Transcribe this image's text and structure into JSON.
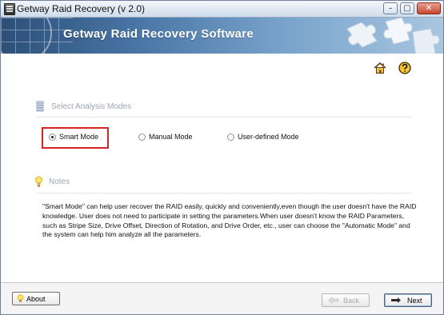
{
  "window": {
    "title": "Getway Raid Recovery (v 2.0)",
    "minimize": "–",
    "maximize": "▢",
    "close": "✕"
  },
  "banner": {
    "title": "Getway Raid Recovery Software"
  },
  "modes_section": {
    "title": "Select Analysis Modes",
    "options": [
      {
        "label": "Smart Mode",
        "selected": true
      },
      {
        "label": "Manual Mode",
        "selected": false
      },
      {
        "label": "User-defined Mode",
        "selected": false
      }
    ]
  },
  "notes_section": {
    "title": "Notes",
    "text": "\"Smart Mode\" can help user recover the RAID easily, quickly and conveniently,even though the user doesn't have the RAID knowledge. User does not need to participate in setting the parameters.When user doesn't know the RAID Parameters, such as Stripe Size, Drive Offset, Direction of Rotation, and Drive Order,  etc., user can choose the \"Automatic Mode\" and the system can help him analyze all the parameters."
  },
  "footer": {
    "about_label": "About",
    "back_label": "Back",
    "next_label": "Next",
    "back_enabled": false
  },
  "colors": {
    "banner_dark": "#2c4f79",
    "highlight": "#d42424",
    "section_title": "#9da6b3"
  },
  "icons": [
    "app-icon",
    "home-icon",
    "help-icon",
    "list-icon",
    "lightbulb-icon",
    "back-arrow-icon",
    "next-arrow-icon"
  ]
}
